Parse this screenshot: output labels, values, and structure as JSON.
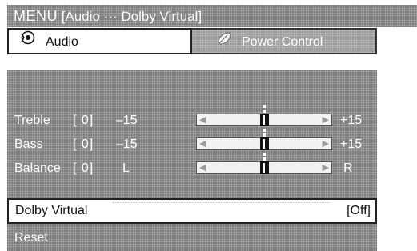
{
  "title": {
    "menu": "MENU",
    "path": "[Audio ··· Dolby Virtual]"
  },
  "tabs": [
    {
      "label": "Audio",
      "icon": "audio-icon",
      "selected": true
    },
    {
      "label": "Power Control",
      "icon": "power-control-icon",
      "selected": false
    }
  ],
  "settings": {
    "treble": {
      "label": "Treble",
      "value": "[  0]",
      "min_label": "–15",
      "max_label": "+15",
      "level": 0.5
    },
    "bass": {
      "label": "Bass",
      "value": "[  0]",
      "min_label": "–15",
      "max_label": "+15",
      "level": 0.5
    },
    "balance": {
      "label": "Balance",
      "value": "[  0]",
      "min_label": "L",
      "max_label": "R",
      "level": 0.5
    }
  },
  "dolby_virtual": {
    "label": "Dolby Virtual",
    "value": "[Off]"
  },
  "reset": {
    "label": "Reset"
  },
  "colors": {
    "panel": "#8c8c8c",
    "selected_bg": "#ffffff",
    "text_light": "#ffffff",
    "text_dark": "#111111"
  }
}
